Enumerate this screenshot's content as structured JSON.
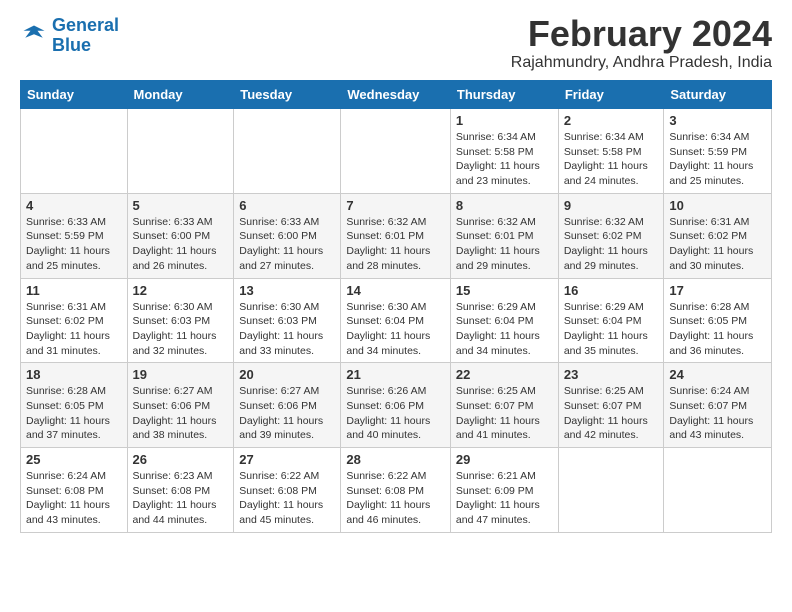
{
  "logo": {
    "line1": "General",
    "line2": "Blue"
  },
  "title": "February 2024",
  "location": "Rajahmundry, Andhra Pradesh, India",
  "weekdays": [
    "Sunday",
    "Monday",
    "Tuesday",
    "Wednesday",
    "Thursday",
    "Friday",
    "Saturday"
  ],
  "weeks": [
    [
      {
        "day": "",
        "info": ""
      },
      {
        "day": "",
        "info": ""
      },
      {
        "day": "",
        "info": ""
      },
      {
        "day": "",
        "info": ""
      },
      {
        "day": "1",
        "info": "Sunrise: 6:34 AM\nSunset: 5:58 PM\nDaylight: 11 hours and 23 minutes."
      },
      {
        "day": "2",
        "info": "Sunrise: 6:34 AM\nSunset: 5:58 PM\nDaylight: 11 hours and 24 minutes."
      },
      {
        "day": "3",
        "info": "Sunrise: 6:34 AM\nSunset: 5:59 PM\nDaylight: 11 hours and 25 minutes."
      }
    ],
    [
      {
        "day": "4",
        "info": "Sunrise: 6:33 AM\nSunset: 5:59 PM\nDaylight: 11 hours and 25 minutes."
      },
      {
        "day": "5",
        "info": "Sunrise: 6:33 AM\nSunset: 6:00 PM\nDaylight: 11 hours and 26 minutes."
      },
      {
        "day": "6",
        "info": "Sunrise: 6:33 AM\nSunset: 6:00 PM\nDaylight: 11 hours and 27 minutes."
      },
      {
        "day": "7",
        "info": "Sunrise: 6:32 AM\nSunset: 6:01 PM\nDaylight: 11 hours and 28 minutes."
      },
      {
        "day": "8",
        "info": "Sunrise: 6:32 AM\nSunset: 6:01 PM\nDaylight: 11 hours and 29 minutes."
      },
      {
        "day": "9",
        "info": "Sunrise: 6:32 AM\nSunset: 6:02 PM\nDaylight: 11 hours and 29 minutes."
      },
      {
        "day": "10",
        "info": "Sunrise: 6:31 AM\nSunset: 6:02 PM\nDaylight: 11 hours and 30 minutes."
      }
    ],
    [
      {
        "day": "11",
        "info": "Sunrise: 6:31 AM\nSunset: 6:02 PM\nDaylight: 11 hours and 31 minutes."
      },
      {
        "day": "12",
        "info": "Sunrise: 6:30 AM\nSunset: 6:03 PM\nDaylight: 11 hours and 32 minutes."
      },
      {
        "day": "13",
        "info": "Sunrise: 6:30 AM\nSunset: 6:03 PM\nDaylight: 11 hours and 33 minutes."
      },
      {
        "day": "14",
        "info": "Sunrise: 6:30 AM\nSunset: 6:04 PM\nDaylight: 11 hours and 34 minutes."
      },
      {
        "day": "15",
        "info": "Sunrise: 6:29 AM\nSunset: 6:04 PM\nDaylight: 11 hours and 34 minutes."
      },
      {
        "day": "16",
        "info": "Sunrise: 6:29 AM\nSunset: 6:04 PM\nDaylight: 11 hours and 35 minutes."
      },
      {
        "day": "17",
        "info": "Sunrise: 6:28 AM\nSunset: 6:05 PM\nDaylight: 11 hours and 36 minutes."
      }
    ],
    [
      {
        "day": "18",
        "info": "Sunrise: 6:28 AM\nSunset: 6:05 PM\nDaylight: 11 hours and 37 minutes."
      },
      {
        "day": "19",
        "info": "Sunrise: 6:27 AM\nSunset: 6:06 PM\nDaylight: 11 hours and 38 minutes."
      },
      {
        "day": "20",
        "info": "Sunrise: 6:27 AM\nSunset: 6:06 PM\nDaylight: 11 hours and 39 minutes."
      },
      {
        "day": "21",
        "info": "Sunrise: 6:26 AM\nSunset: 6:06 PM\nDaylight: 11 hours and 40 minutes."
      },
      {
        "day": "22",
        "info": "Sunrise: 6:25 AM\nSunset: 6:07 PM\nDaylight: 11 hours and 41 minutes."
      },
      {
        "day": "23",
        "info": "Sunrise: 6:25 AM\nSunset: 6:07 PM\nDaylight: 11 hours and 42 minutes."
      },
      {
        "day": "24",
        "info": "Sunrise: 6:24 AM\nSunset: 6:07 PM\nDaylight: 11 hours and 43 minutes."
      }
    ],
    [
      {
        "day": "25",
        "info": "Sunrise: 6:24 AM\nSunset: 6:08 PM\nDaylight: 11 hours and 43 minutes."
      },
      {
        "day": "26",
        "info": "Sunrise: 6:23 AM\nSunset: 6:08 PM\nDaylight: 11 hours and 44 minutes."
      },
      {
        "day": "27",
        "info": "Sunrise: 6:22 AM\nSunset: 6:08 PM\nDaylight: 11 hours and 45 minutes."
      },
      {
        "day": "28",
        "info": "Sunrise: 6:22 AM\nSunset: 6:08 PM\nDaylight: 11 hours and 46 minutes."
      },
      {
        "day": "29",
        "info": "Sunrise: 6:21 AM\nSunset: 6:09 PM\nDaylight: 11 hours and 47 minutes."
      },
      {
        "day": "",
        "info": ""
      },
      {
        "day": "",
        "info": ""
      }
    ]
  ]
}
